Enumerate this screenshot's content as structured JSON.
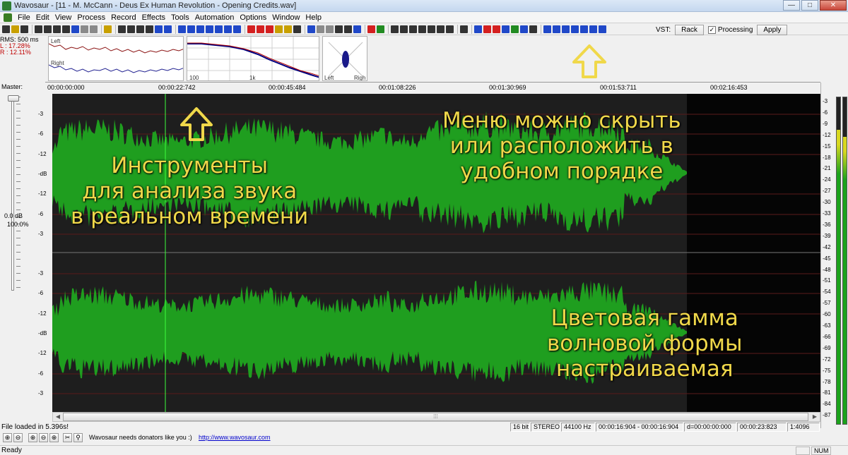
{
  "window": {
    "title": "Wavosaur - [11 - M. McCann - Deus Ex Human Revolution - Opening Credits.wav]",
    "minimize": "—",
    "maximize": "□",
    "close": "✕"
  },
  "menu": [
    "File",
    "Edit",
    "View",
    "Process",
    "Record",
    "Effects",
    "Tools",
    "Automation",
    "Options",
    "Window",
    "Help"
  ],
  "vst": {
    "label": "VST:",
    "rack_button": "Rack",
    "processing_checked": true,
    "processing_label": "Processing",
    "apply_button": "Apply"
  },
  "rms": {
    "line1": "RMS: 500 ms",
    "line2": "L : 17.28%",
    "line3": "R : 12.11%"
  },
  "scope": {
    "left_label": "Left",
    "right_label": "Right"
  },
  "spectrum": {
    "label_100": "100",
    "label_1k": "1k"
  },
  "phase": {
    "left_label": "Left",
    "right_label": "Righ"
  },
  "timeline": [
    "00:00:00:000",
    "00:00:22:742",
    "00:00:45:484",
    "00:01:08:226",
    "00:01:30:969",
    "00:01:53:711",
    "00:02:16:453"
  ],
  "master": {
    "label": "Master:",
    "db": "0.0 dB",
    "percent": "100.0%"
  },
  "db_scale": [
    "-3",
    "-6",
    "-12",
    "-dB",
    "-12",
    "-6",
    "-3",
    "-3",
    "-6",
    "-12",
    "-dB",
    "-12",
    "-6",
    "-3"
  ],
  "meter_scale": [
    "-3",
    "-6",
    "-9",
    "-12",
    "-15",
    "-18",
    "-21",
    "-24",
    "-27",
    "-30",
    "-33",
    "-36",
    "-39",
    "-42",
    "-45",
    "-48",
    "-51",
    "-54",
    "-57",
    "-60",
    "-63",
    "-66",
    "-69",
    "-72",
    "-75",
    "-78",
    "-81",
    "-84",
    "-87"
  ],
  "meter_levels": {
    "left": 0.9,
    "right": 0.88
  },
  "overlays": {
    "tools_text": [
      "Инструменты",
      "для анализа звука",
      "в реальном времени"
    ],
    "menu_text": [
      "Меню можно скрыть",
      "или расположить в",
      "удобном порядке"
    ],
    "color_text": [
      "Цветовая гамма",
      "волновой формы",
      "настраиваемая"
    ]
  },
  "status": {
    "message": "File loaded in 5.396s!",
    "bit_depth": "16 bit",
    "channels": "STEREO",
    "sample_rate": "44100 Hz",
    "selection": "00:00:16:904 - 00:00:16:904",
    "duration_sel": "d=00:00:00:000",
    "length": "00:00:23:823",
    "zoom": "1:4096"
  },
  "bottom": {
    "donate_text": "Wavosaur needs donators like you :)",
    "link_text": "http://www.wavosaur.com",
    "ready": "Ready",
    "num": "NUM"
  },
  "colors": {
    "waveform": "#1f9e1f",
    "waveform_bg": "#1e1e1e",
    "overlay_text": "#f0d84a",
    "cursor": "#3cff3c"
  }
}
